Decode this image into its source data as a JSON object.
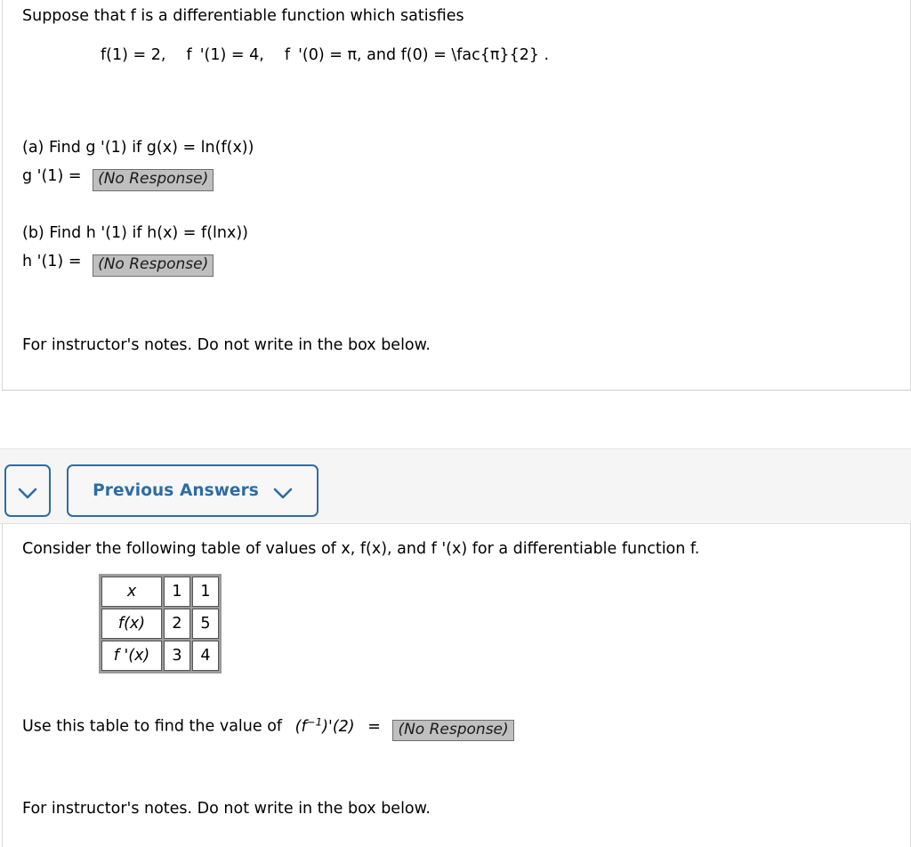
{
  "problem1": {
    "intro": "Suppose that f is a differentiable function which satisfies",
    "givens": "f(1) = 2,  f  '(1) = 4,  f  '(0) = π, and f(0) = \\fac{π}{2} .",
    "part_a_prompt": "(a) Find g '(1) if  g(x) = ln(f(x))",
    "part_a_answer_label": "g '(1) =",
    "part_a_answer_value": "(No Response)",
    "part_b_prompt": "(b) Find h '(1) if  h(x) = f(lnx))",
    "part_b_answer_label": "h '(1) =",
    "part_b_answer_value": "(No Response)",
    "instructor_note": "For instructor's notes. Do not write in the box below."
  },
  "toolbar": {
    "toggle_icon": "chevron-down-icon",
    "previous_answers_label": "Previous Answers",
    "previous_answers_icon": "chevron-down-icon",
    "accent_color": "#2e6ca4",
    "panel_color": "#f5f5f5"
  },
  "problem2": {
    "intro": "Consider the following table of values of  x, f(x), and f '(x)  for a differentiable function f.",
    "table": {
      "rows": [
        {
          "label": "x",
          "label_style": "italic",
          "values": [
            "1",
            "1"
          ]
        },
        {
          "label": "f(x)",
          "label_style": "italic",
          "values": [
            "2",
            "5"
          ]
        },
        {
          "label": "f '(x)",
          "label_style": "italic",
          "values": [
            "3",
            "4"
          ]
        }
      ]
    },
    "question_prefix": "Use this table to find the value of",
    "question_expr_base": "(f",
    "question_expr_sup": "−1",
    "question_expr_tail": ")'(2)",
    "equals": "=",
    "answer_value": "(No Response)",
    "instructor_note": "For instructor's notes. Do not write in the box below."
  }
}
